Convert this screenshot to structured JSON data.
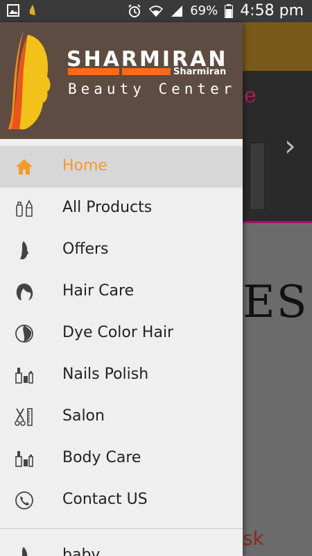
{
  "status_bar": {
    "battery_percent": "69%",
    "time": "4:58 pm",
    "icons": [
      "gallery-icon",
      "notification-icon",
      "alarm-icon",
      "wifi-icon",
      "signal-icon",
      "battery-icon"
    ]
  },
  "drawer_header": {
    "brand_title": "SHARMIRAN",
    "brand_sub": "Sharmiran",
    "brand_tagline": "Beauty Center",
    "accent": "#ff6a1a",
    "header_bg": "#5e4b41"
  },
  "menu": {
    "items": [
      {
        "label": "Home",
        "icon": "home-icon",
        "active": true
      },
      {
        "label": "All Products",
        "icon": "cosmetics-icon",
        "active": false
      },
      {
        "label": "Offers",
        "icon": "woman-silhouette-icon",
        "active": false
      },
      {
        "label": "Hair Care",
        "icon": "hair-icon",
        "active": false
      },
      {
        "label": "Dye Color Hair",
        "icon": "dye-icon",
        "active": false
      },
      {
        "label": "Nails Polish",
        "icon": "nail-polish-icon",
        "active": false
      },
      {
        "label": "Salon",
        "icon": "scissors-comb-icon",
        "active": false
      },
      {
        "label": "Body Care",
        "icon": "body-care-icon",
        "active": false
      },
      {
        "label": "Contact US",
        "icon": "phone-icon",
        "active": false
      }
    ],
    "extra_label": "baby",
    "active_color": "#f39a2c"
  },
  "background": {
    "partial_text_es": "ES",
    "partial_text_sk": "sk",
    "partial_text_e": "e"
  }
}
